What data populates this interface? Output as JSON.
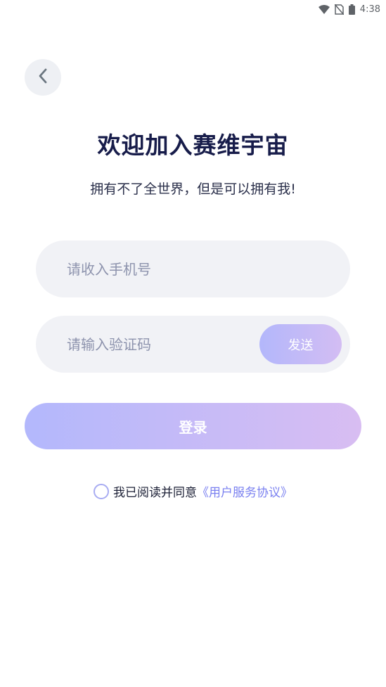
{
  "status_bar": {
    "time": "4:38"
  },
  "header": {
    "title": "欢迎加入赛维宇宙",
    "subtitle": "拥有不了全世界，但是可以拥有我!"
  },
  "form": {
    "phone_placeholder": "请收入手机号",
    "code_placeholder": "请输入验证码",
    "send_label": "发送",
    "login_label": "登录"
  },
  "agreement": {
    "text": "我已阅读并同意",
    "link": "《用户服务协议》"
  },
  "colors": {
    "accent_start": "#b3b8fc",
    "accent_end": "#d8bdf2",
    "link": "#7a80f0",
    "title": "#171c4a"
  }
}
